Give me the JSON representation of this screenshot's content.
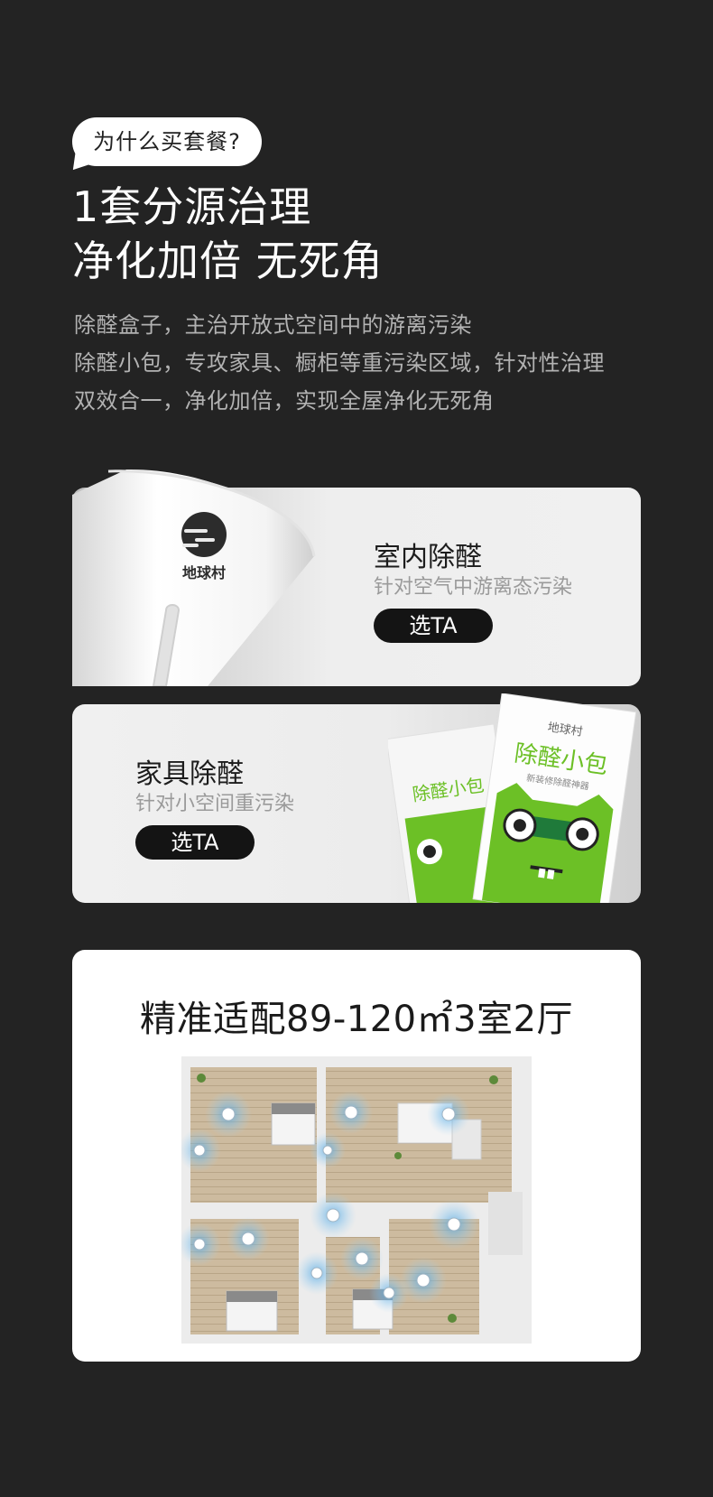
{
  "bubble": {
    "text": "为什么买套餐?"
  },
  "headline": {
    "line1": "1套分源治理",
    "line2": "净化加倍 无死角"
  },
  "description": [
    "除醛盒子，主治开放式空间中的游离污染",
    "除醛小包，专攻家具、橱柜等重污染区域，针对性治理",
    "双效合一，净化加倍，实现全屋净化无死角"
  ],
  "cards": [
    {
      "title": "室内除醛",
      "subtitle": "针对空气中游离态污染",
      "button": "选TA",
      "brand": "地球村"
    },
    {
      "title": "家具除醛",
      "subtitle": "针对小空间重污染",
      "button": "选TA",
      "pack_brand": "地球村",
      "pack_title": "除醛小包",
      "pack_small": "新装修除醛神器"
    }
  ],
  "plan": {
    "title": "精准适配89-120㎡3室2厅"
  },
  "colors": {
    "background": "#232323",
    "accent_green": "#6cc026",
    "pill": "#141414"
  }
}
